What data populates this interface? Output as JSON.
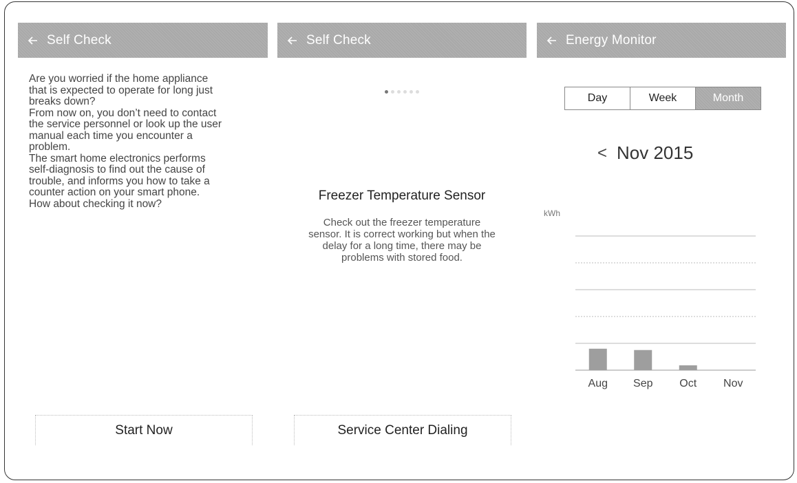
{
  "panel1": {
    "header_title": "Self Check",
    "intro": [
      "Are you worried if the home appliance",
      "that is expected to operate for long just",
      "breaks down?",
      "From now on, you don’t need to contact",
      "the service personnel or look up the user",
      "manual each time you encounter a",
      "problem.",
      "The smart home electronics performs",
      "self-diagnosis to find out the cause of",
      "trouble, and informs you how to take a",
      "counter action on your smart phone.",
      "How about checking it now?"
    ],
    "button_label": "Start Now"
  },
  "panel2": {
    "header_title": "Self Check",
    "page_indicator": {
      "total": 6,
      "current": 1
    },
    "sensor_title": "Freezer Temperature Sensor",
    "sensor_desc": [
      "Check out the freezer temperature",
      "sensor. It is correct working but when the",
      "delay for a long time, there may be",
      "problems with stored food."
    ],
    "button_label": "Service Center Dialing"
  },
  "panel3": {
    "header_title": "Energy Monitor",
    "segments": [
      "Day",
      "Week",
      "Month"
    ],
    "active_segment": "Month",
    "month_label": "Nov 2015",
    "prev_glyph": "<"
  },
  "chart_data": {
    "type": "bar",
    "ylabel": "kWh",
    "categories": [
      "Aug",
      "Sep",
      "Oct",
      "Nov"
    ],
    "values": [
      0.8,
      0.75,
      0.18,
      0
    ],
    "ylim": [
      0,
      5
    ],
    "grid": true
  },
  "colors": {
    "header_bg": "#a9a9a9",
    "bar": "#9e9e9e",
    "text": "#222222"
  }
}
